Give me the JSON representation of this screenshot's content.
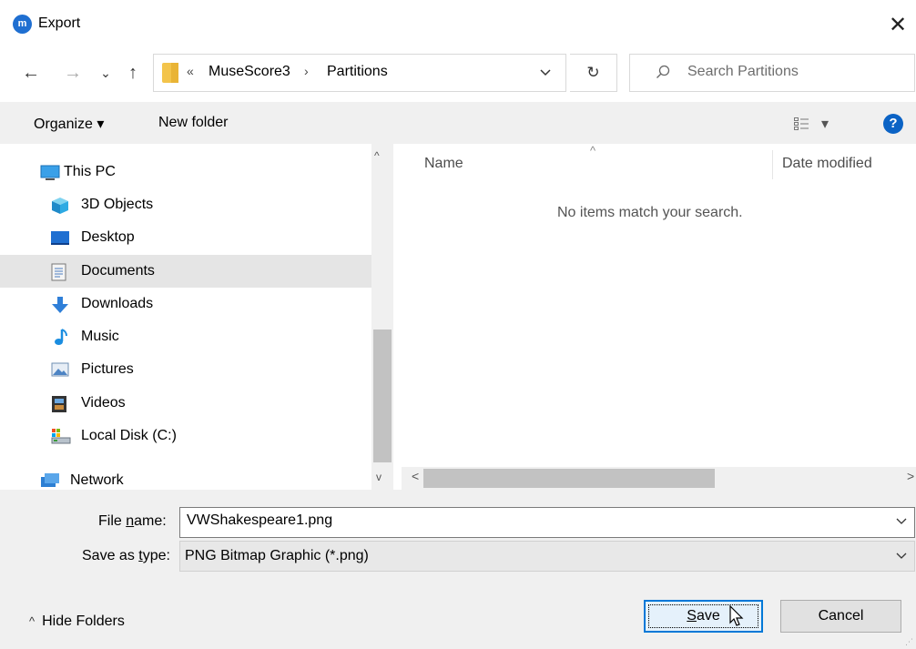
{
  "window": {
    "title": "Export",
    "logo_text": "m",
    "close_glyph": "✕"
  },
  "nav": {
    "back_glyph": "←",
    "forward_glyph": "→",
    "recent_glyph": "⌄",
    "up_glyph": "↑"
  },
  "address": {
    "overflow_glyph": "«",
    "crumbs": [
      "MuseScore3",
      "Partitions"
    ],
    "separator": "›",
    "refresh_glyph": "↻"
  },
  "search": {
    "placeholder": "Search Partitions",
    "icon": "search-icon"
  },
  "toolbar": {
    "organize_label": "Organize ▾",
    "new_folder_label": "New folder",
    "view_glyph": "▾",
    "help_glyph": "?"
  },
  "sidebar": {
    "items": [
      {
        "label": "This PC",
        "icon": "monitor-icon",
        "selected": false
      },
      {
        "label": "3D Objects",
        "icon": "cube-icon",
        "selected": false
      },
      {
        "label": "Desktop",
        "icon": "desktop-icon",
        "selected": false
      },
      {
        "label": "Documents",
        "icon": "documents-icon",
        "selected": true
      },
      {
        "label": "Downloads",
        "icon": "download-arrow-icon",
        "selected": false
      },
      {
        "label": "Music",
        "icon": "music-note-icon",
        "selected": false
      },
      {
        "label": "Pictures",
        "icon": "pictures-icon",
        "selected": false
      },
      {
        "label": "Videos",
        "icon": "film-icon",
        "selected": false
      },
      {
        "label": "Local Disk (C:)",
        "icon": "drive-icon",
        "selected": false
      },
      {
        "label": "Network",
        "icon": "network-icon",
        "selected": false
      }
    ],
    "scroll_up": "^",
    "scroll_down": "v"
  },
  "files": {
    "columns": [
      "Name",
      "Date modified"
    ],
    "sort_caret": "^",
    "empty_message": "No items match your search.",
    "scroll_left": "<",
    "scroll_right": ">"
  },
  "form": {
    "file_name_label_pre": "File ",
    "file_name_label_key": "n",
    "file_name_label_post": "ame:",
    "file_name_value": "VWShakespeare1.png",
    "save_type_label_pre": "Save as ",
    "save_type_label_key": "t",
    "save_type_label_post": "ype:",
    "save_type_value": "PNG Bitmap Graphic (*.png)",
    "chevron": "⌄"
  },
  "footer": {
    "hide_folders_label": "Hide Folders",
    "hide_folders_glyph": "^",
    "save_label_key": "S",
    "save_label_rest": "ave",
    "cancel_label": "Cancel"
  },
  "colors": {
    "accent": "#0078d7",
    "selected_bg": "#e5e5e5",
    "panel_bg": "#f0f0f0",
    "help_blue": "#0b63c5"
  }
}
